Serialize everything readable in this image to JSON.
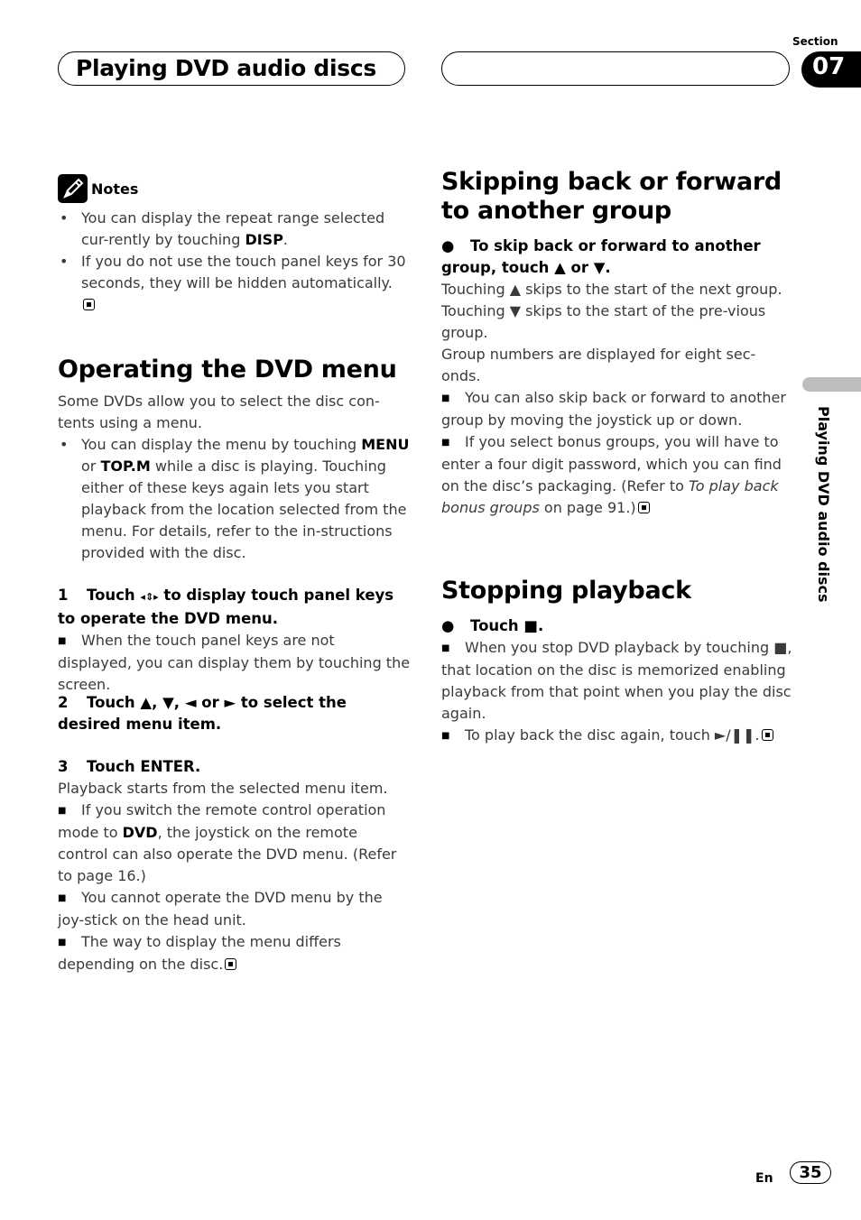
{
  "header": {
    "chapter_title": "Playing DVD audio discs",
    "section_label": "Section",
    "section_number": "07"
  },
  "side_tab": {
    "label": "Playing DVD audio discs"
  },
  "notes": {
    "title": "Notes",
    "icon": "pencil-icon",
    "items": [
      {
        "pre": "You can display the repeat range selected cur-rently by touching ",
        "bold": "DISP",
        "post": "."
      },
      {
        "text": "If you do not use the touch panel keys for 30 seconds, they will be hidden automatically."
      }
    ]
  },
  "dvd_menu": {
    "title": "Operating the DVD menu",
    "intro": "Some DVDs allow you to select the disc con-tents using a menu.",
    "bullet": {
      "pre": "You can display the menu by touching ",
      "bold1": "MENU",
      "mid": " or ",
      "bold2": "TOP.M",
      "post": " while a disc is playing. Touching either of these keys again lets you start playback from the location selected from the menu. For details, refer to the in-structions provided with the disc."
    },
    "step1": {
      "num": "1",
      "pre": "Touch ",
      "icon": "joystick-arrows-icon",
      "post": " to display touch panel keys to operate the DVD menu.",
      "note": "When the touch panel keys are not displayed, you can display them by touching the screen."
    },
    "step2": {
      "num": "2",
      "text": "Touch ▲, ▼, ◄ or ► to select the desired menu item."
    },
    "step3": {
      "num": "3",
      "text": "Touch ENTER.",
      "body": "Playback starts from the selected menu item.",
      "notes": [
        {
          "pre": "If you switch the remote control operation mode to ",
          "bold": "DVD",
          "post": ", the joystick on the remote control can also operate the DVD menu. (Refer to page 16.)"
        },
        {
          "text": "You cannot operate the DVD menu by the joy-stick on the head unit."
        },
        {
          "text": "The way to display the menu differs depending on the disc."
        }
      ]
    }
  },
  "skip_group": {
    "title": "Skipping back or forward to another group",
    "instruction": "To skip back or forward to another group, touch ▲ or ▼.",
    "body1": "Touching ▲ skips to the start of the next group. Touching ▼ skips to the start of the pre-vious group.",
    "body2": "Group numbers are displayed for eight sec-onds.",
    "notes": [
      {
        "text": "You can also skip back or forward to another group by moving the joystick up or down."
      },
      {
        "pre": "If you select bonus groups, you will have to enter a four digit password, which you can find on the disc’s packaging. (Refer to ",
        "italic": "To play back bonus groups",
        "post": " on page 91.)"
      }
    ]
  },
  "stopping": {
    "title": "Stopping playback",
    "instruction": "Touch ■.",
    "notes": [
      {
        "text": "When you stop DVD playback by touching ■, that location on the disc is memorized enabling playback from that point when you play the disc again."
      },
      {
        "text": "To play back the disc again, touch ►/❚❚."
      }
    ]
  },
  "footer": {
    "language": "En",
    "page_number": "35"
  }
}
